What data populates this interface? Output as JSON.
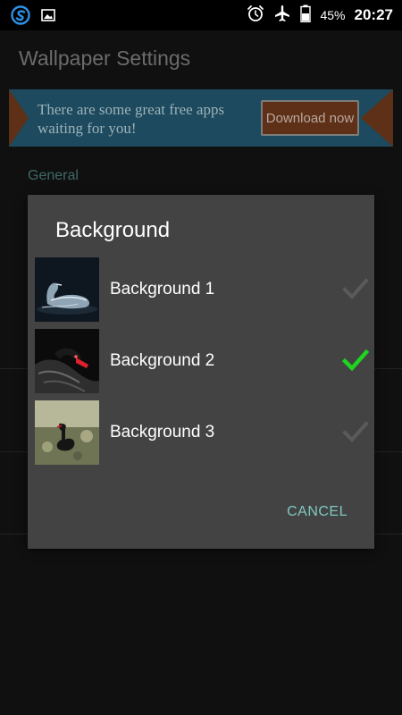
{
  "status_bar": {
    "battery": "45%",
    "time": "20:27",
    "icons": [
      "s-logo-icon",
      "image-icon",
      "alarm-icon",
      "airplane-icon",
      "battery-icon"
    ]
  },
  "app": {
    "title": "Wallpaper Settings",
    "ad": {
      "text": "There are some great free apps waiting for you!",
      "button": "Download now"
    },
    "section": "General"
  },
  "dialog": {
    "title": "Background",
    "options": [
      {
        "label": "Background 1",
        "selected": false
      },
      {
        "label": "Background 2",
        "selected": true
      },
      {
        "label": "Background 3",
        "selected": false
      }
    ],
    "cancel": "CANCEL"
  },
  "colors": {
    "accent": "#7fc7c2",
    "check_selected": "#1fd41f",
    "check_unselected": "#5a5a5a",
    "dialog_bg": "#434343"
  }
}
